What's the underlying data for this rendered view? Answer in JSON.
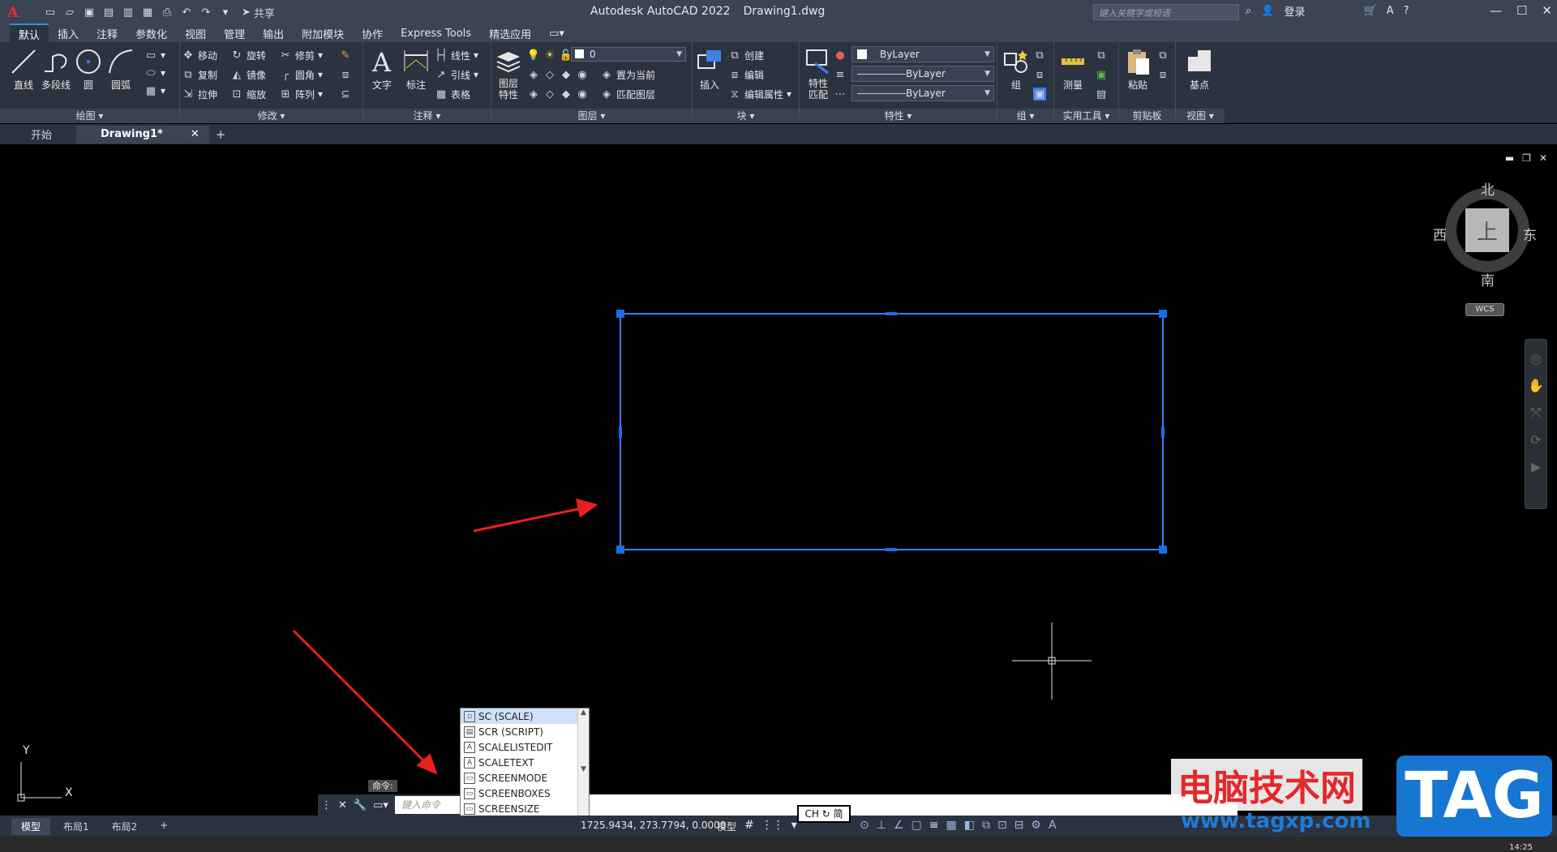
{
  "titlebar": {
    "app_logo": "A",
    "share_label": "共享",
    "product": "Autodesk AutoCAD 2022",
    "document": "Drawing1.dwg",
    "search_placeholder": "键入关键字或短语",
    "login_label": "登录"
  },
  "ribbon_tabs": [
    {
      "label": "默认",
      "active": true
    },
    {
      "label": "插入"
    },
    {
      "label": "注释"
    },
    {
      "label": "参数化"
    },
    {
      "label": "视图"
    },
    {
      "label": "管理"
    },
    {
      "label": "输出"
    },
    {
      "label": "附加模块"
    },
    {
      "label": "协作"
    },
    {
      "label": "Express Tools"
    },
    {
      "label": "精选应用"
    }
  ],
  "ribbon": {
    "draw": {
      "title": "绘图",
      "line": "直线",
      "polyline": "多段线",
      "circle": "圆",
      "arc": "圆弧"
    },
    "modify": {
      "title": "修改",
      "move": "移动",
      "rotate": "旋转",
      "trim": "修剪",
      "copy": "复制",
      "mirror": "镜像",
      "fillet": "圆角",
      "stretch": "拉伸",
      "scale": "缩放",
      "array": "阵列"
    },
    "annotation": {
      "title": "注释",
      "text": "文字",
      "dimension": "标注",
      "linear": "线性",
      "leader": "引线",
      "table": "表格"
    },
    "layers": {
      "title": "图层",
      "layer_props": "图层\n特性",
      "current_layer": "0",
      "make_current": "置为当前",
      "match_layer": "匹配图层"
    },
    "block": {
      "title": "块",
      "insert": "插入",
      "create": "创建",
      "edit": "编辑",
      "edit_attr": "编辑属性"
    },
    "properties": {
      "title": "特性",
      "match": "特性\n匹配",
      "color": "ByLayer",
      "linetype": "ByLayer",
      "lineweight": "ByLayer"
    },
    "groups": {
      "title": "组",
      "group": "组"
    },
    "utilities": {
      "title": "实用工具",
      "measure": "测量"
    },
    "clipboard": {
      "title": "剪贴板",
      "paste": "粘贴"
    },
    "view": {
      "title": "视图",
      "base": "基点"
    }
  },
  "doc_tabs": [
    {
      "label": "开始"
    },
    {
      "label": "Drawing1*",
      "active": true
    }
  ],
  "viewcube": {
    "north": "北",
    "south": "南",
    "east": "东",
    "west": "西",
    "face": "上",
    "wcs": "WCS"
  },
  "ucs": {
    "x": "X",
    "y": "Y"
  },
  "command": {
    "label": "命令:",
    "placeholder": "键入命令",
    "typed": "SC",
    "suggestions": [
      "SC (SCALE)",
      "SCR (SCRIPT)",
      "SCALELISTEDIT",
      "SCALETEXT",
      "SCREENMODE",
      "SCREENBOXES",
      "SCREENSIZE"
    ]
  },
  "statusbar": {
    "layouts": [
      {
        "label": "模型",
        "active": true
      },
      {
        "label": "布局1"
      },
      {
        "label": "布局2"
      }
    ],
    "coordinates": "1725.9434, 273.7794, 0.0000",
    "model_label": "模型",
    "ime": "CH ↻ 简",
    "clock": "14:25"
  },
  "watermark": {
    "site_cn": "电脑技术网",
    "url": "www.tagxp.com",
    "tag": "TAG"
  },
  "colors": {
    "selection": "#3f7fe6",
    "grip": "#1c6be8",
    "arrow": "#e8201f",
    "ribbon_bg": "#2c3340"
  }
}
